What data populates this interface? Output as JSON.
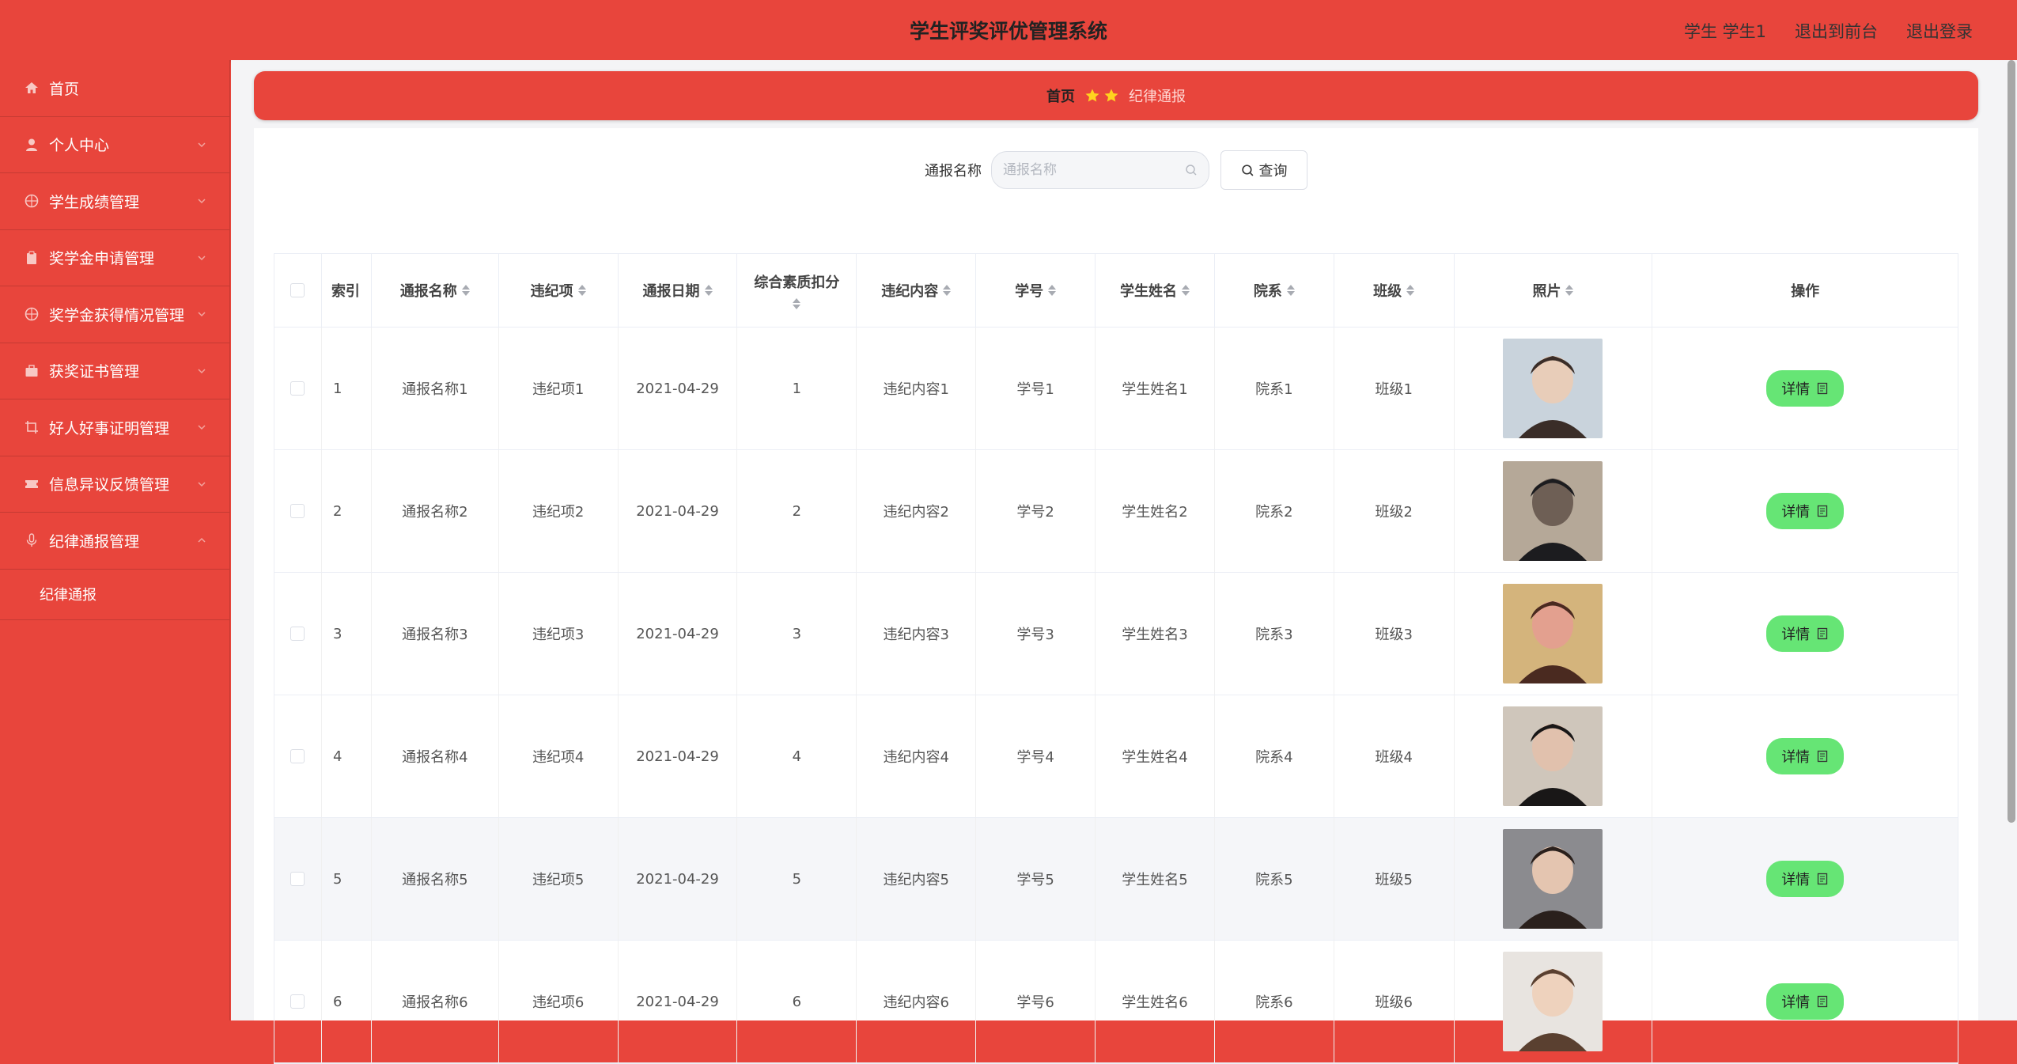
{
  "header": {
    "title": "学生评奖评优管理系统",
    "user": "学生 学生1",
    "to_front": "退出到前台",
    "logout": "退出登录"
  },
  "sidebar": {
    "items": [
      {
        "label": "首页",
        "icon": "home-icon",
        "expandable": false
      },
      {
        "label": "个人中心",
        "icon": "user-icon",
        "expandable": true
      },
      {
        "label": "学生成绩管理",
        "icon": "basketball-icon",
        "expandable": true
      },
      {
        "label": "奖学金申请管理",
        "icon": "clipboard-icon",
        "expandable": true
      },
      {
        "label": "奖学金获得情况管理",
        "icon": "basketball-icon",
        "expandable": true
      },
      {
        "label": "获奖证书管理",
        "icon": "briefcase-icon",
        "expandable": true
      },
      {
        "label": "好人好事证明管理",
        "icon": "crop-icon",
        "expandable": true
      },
      {
        "label": "信息异议反馈管理",
        "icon": "ticket-icon",
        "expandable": true
      },
      {
        "label": "纪律通报管理",
        "icon": "microphone-icon",
        "expandable": true,
        "expanded": true
      }
    ],
    "sub_item": "纪律通报"
  },
  "breadcrumb": {
    "home": "首页",
    "current": "纪律通报"
  },
  "search": {
    "label": "通报名称",
    "placeholder": "通报名称",
    "button": "查询"
  },
  "table": {
    "headers": [
      "索引",
      "通报名称",
      "违纪项",
      "通报日期",
      "综合素质扣分",
      "违纪内容",
      "学号",
      "学生姓名",
      "院系",
      "班级",
      "照片",
      "操作"
    ],
    "action_label": "详情",
    "rows": [
      {
        "index": "1",
        "name": "通报名称1",
        "item": "违纪项1",
        "date": "2021-04-29",
        "score": "1",
        "content": "违纪内容1",
        "sid": "学号1",
        "sname": "学生姓名1",
        "dept": "院系1",
        "cls": "班级1"
      },
      {
        "index": "2",
        "name": "通报名称2",
        "item": "违纪项2",
        "date": "2021-04-29",
        "score": "2",
        "content": "违纪内容2",
        "sid": "学号2",
        "sname": "学生姓名2",
        "dept": "院系2",
        "cls": "班级2"
      },
      {
        "index": "3",
        "name": "通报名称3",
        "item": "违纪项3",
        "date": "2021-04-29",
        "score": "3",
        "content": "违纪内容3",
        "sid": "学号3",
        "sname": "学生姓名3",
        "dept": "院系3",
        "cls": "班级3"
      },
      {
        "index": "4",
        "name": "通报名称4",
        "item": "违纪项4",
        "date": "2021-04-29",
        "score": "4",
        "content": "违纪内容4",
        "sid": "学号4",
        "sname": "学生姓名4",
        "dept": "院系4",
        "cls": "班级4"
      },
      {
        "index": "5",
        "name": "通报名称5",
        "item": "违纪项5",
        "date": "2021-04-29",
        "score": "5",
        "content": "违纪内容5",
        "sid": "学号5",
        "sname": "学生姓名5",
        "dept": "院系5",
        "cls": "班级5"
      },
      {
        "index": "6",
        "name": "通报名称6",
        "item": "违纪项6",
        "date": "2021-04-29",
        "score": "6",
        "content": "违纪内容6",
        "sid": "学号6",
        "sname": "学生姓名6",
        "dept": "院系6",
        "cls": "班级6"
      }
    ]
  },
  "colors": {
    "primary": "#e8453c",
    "detail_button": "#66e575",
    "star": "#ffd21f"
  }
}
